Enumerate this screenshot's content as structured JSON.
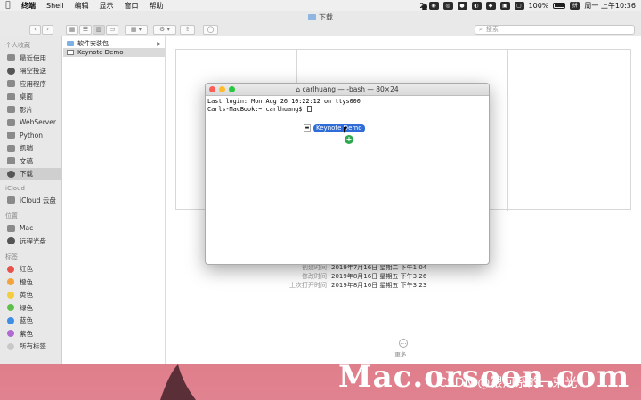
{
  "menubar": {
    "app_items": [
      "终端",
      "Shell",
      "编辑",
      "显示",
      "窗口",
      "帮助"
    ],
    "right_count": "2",
    "battery": "100%",
    "clock": "周一 上午10:36"
  },
  "finder": {
    "title": "下载",
    "search_placeholder": "搜索",
    "sidebar": {
      "favorites_header": "个人收藏",
      "favorites": [
        "最近使用",
        "隔空投送",
        "应用程序",
        "桌面",
        "影片",
        "WebServer",
        "Python",
        "凯瑞",
        "文稿",
        "下载"
      ],
      "icloud_header": "iCloud",
      "icloud": [
        "iCloud 云盘"
      ],
      "locations_header": "位置",
      "locations": [
        "Mac",
        "远程光盘"
      ],
      "tags_header": "标签",
      "tags": [
        {
          "label": "红色",
          "color": "#e9524a"
        },
        {
          "label": "橙色",
          "color": "#f4a23a"
        },
        {
          "label": "黄色",
          "color": "#f3cd3d"
        },
        {
          "label": "绿色",
          "color": "#5fbf4c"
        },
        {
          "label": "蓝色",
          "color": "#3f8ee6"
        },
        {
          "label": "紫色",
          "color": "#b06ad2"
        },
        {
          "label": "所有标签...",
          "color": "#c8c8c8"
        }
      ]
    },
    "column": [
      "软件安装包",
      "Keynote Demo"
    ],
    "info": [
      {
        "label": "创建时间",
        "value": "2019年7月16日 星期二 下午1:04"
      },
      {
        "label": "修改时间",
        "value": "2019年8月16日 星期五 下午3:26"
      },
      {
        "label": "上次打开时间",
        "value": "2019年8月16日 星期五 下午3:23"
      }
    ],
    "more_label": "更多..."
  },
  "terminal": {
    "title": "carlhuang — -bash — 80×24",
    "lines": [
      "Last login: Mon Aug 26 10:22:12 on ttys000",
      "Carls-MacBook:~ carlhuang$"
    ]
  },
  "drag_label": "Keynote Demo",
  "watermark": "Mac.orsoon.com",
  "credit": "CSDN @银河系的一束光"
}
